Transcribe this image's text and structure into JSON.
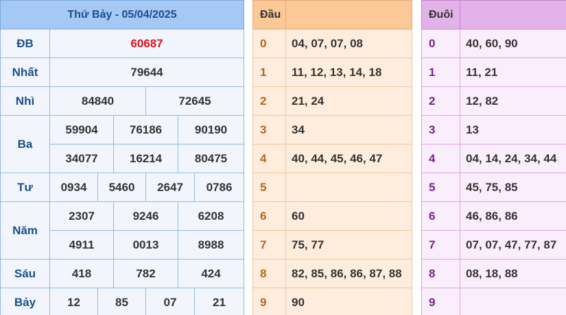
{
  "results": {
    "title": "Thứ Bảy - 05/04/2025",
    "db": {
      "label": "ĐB",
      "values": [
        "60687"
      ]
    },
    "nhat": {
      "label": "Nhất",
      "values": [
        "79644"
      ]
    },
    "nhi": {
      "label": "Nhì",
      "values": [
        "84840",
        "72645"
      ]
    },
    "ba": {
      "label": "Ba",
      "values": [
        "59904",
        "76186",
        "90190",
        "34077",
        "16214",
        "80475"
      ]
    },
    "tu": {
      "label": "Tư",
      "values": [
        "0934",
        "5460",
        "2647",
        "0786"
      ]
    },
    "nam": {
      "label": "Năm",
      "values": [
        "2307",
        "9246",
        "6208",
        "4911",
        "0013",
        "8988"
      ]
    },
    "sau": {
      "label": "Sáu",
      "values": [
        "418",
        "782",
        "424"
      ]
    },
    "bay": {
      "label": "Bảy",
      "values": [
        "12",
        "85",
        "07",
        "21"
      ]
    }
  },
  "dau": {
    "header": "Đầu",
    "rows": [
      {
        "num": "0",
        "values": "04, 07, 07, 08"
      },
      {
        "num": "1",
        "values": "11, 12, 13, 14, 18"
      },
      {
        "num": "2",
        "values": "21, 24"
      },
      {
        "num": "3",
        "values": "34"
      },
      {
        "num": "4",
        "values": "40, 44, 45, 46, 47"
      },
      {
        "num": "5",
        "values": ""
      },
      {
        "num": "6",
        "values": "60"
      },
      {
        "num": "7",
        "values": "75, 77"
      },
      {
        "num": "8",
        "values": "82, 85, 86, 86, 87, 88"
      },
      {
        "num": "9",
        "values": "90"
      }
    ]
  },
  "duoi": {
    "header": "Đuôi",
    "rows": [
      {
        "num": "0",
        "values": "40, 60, 90"
      },
      {
        "num": "1",
        "values": "11, 21"
      },
      {
        "num": "2",
        "values": "12, 82"
      },
      {
        "num": "3",
        "values": "13"
      },
      {
        "num": "4",
        "values": "04, 14, 24, 34, 44"
      },
      {
        "num": "5",
        "values": "45, 75, 85"
      },
      {
        "num": "6",
        "values": "46, 86, 86"
      },
      {
        "num": "7",
        "values": "07, 07, 47, 77, 87"
      },
      {
        "num": "8",
        "values": "08, 18, 88"
      },
      {
        "num": "9",
        "values": ""
      }
    ]
  },
  "colors": {
    "results_header": "#a5c8f5",
    "dau_header": "#fbc998",
    "duoi_header": "#e3b2e8",
    "special_prize": "#e0101a"
  }
}
